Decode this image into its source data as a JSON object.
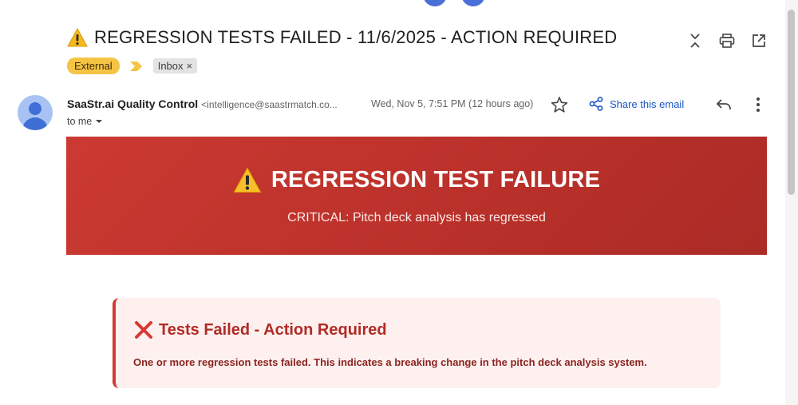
{
  "email": {
    "subject": "REGRESSION TESTS FAILED - 11/6/2025 - ACTION REQUIRED",
    "labels": {
      "external": "External",
      "inbox": "Inbox",
      "remove": "×"
    },
    "sender": {
      "name": "SaaStr.ai Quality Control",
      "email": "<intelligence@saastrmatch.co...",
      "timestamp": "Wed, Nov 5, 7:51 PM (12 hours ago)",
      "to": "to me"
    },
    "share_label": "Share this email",
    "icons": {
      "collapse": "collapse-icon",
      "print": "print-icon",
      "open_new": "open-in-new-icon",
      "star": "star-icon",
      "share": "share-icon",
      "reply": "reply-icon",
      "more": "more-vert-icon",
      "warning": "warning-icon",
      "fail": "cross-mark-icon"
    }
  },
  "banner": {
    "title": "REGRESSION TEST FAILURE",
    "subtitle": "CRITICAL: Pitch deck analysis has regressed",
    "color": "#c0342d"
  },
  "card": {
    "title": "Tests Failed - Action Required",
    "body": "One or more regression tests failed. This indicates a breaking change in the pitch deck analysis system.",
    "accent": "#d43a33",
    "background": "#fdf0ef"
  },
  "colors": {
    "link": "#1a56c4",
    "external_chip": "#f6c445"
  }
}
